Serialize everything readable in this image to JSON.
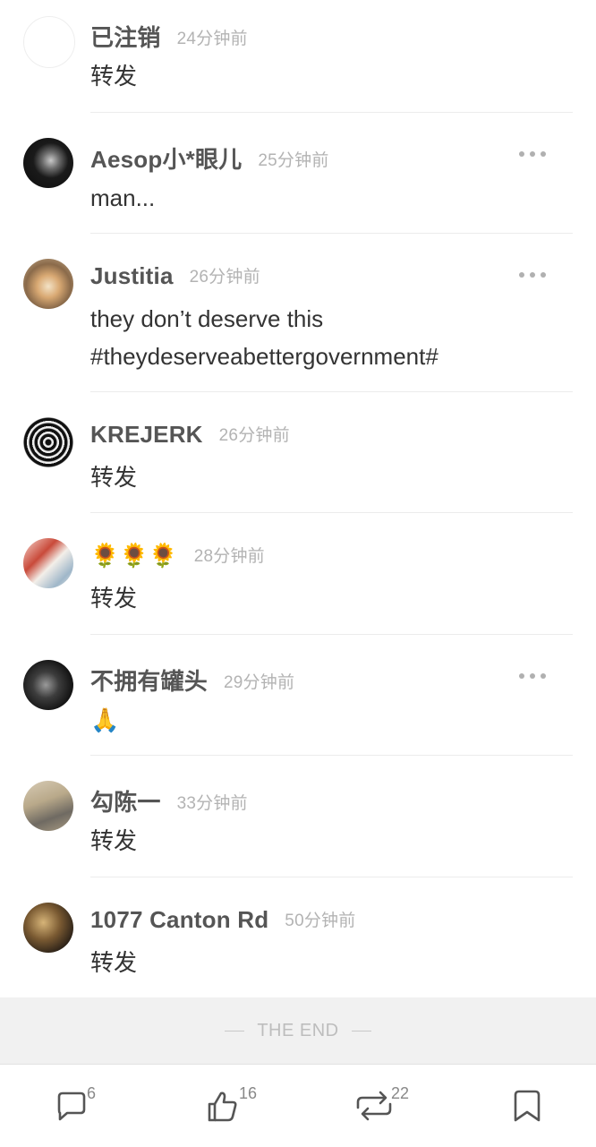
{
  "comments": [
    {
      "name": "已注销",
      "time": "24分钟前",
      "text": "转发",
      "more": false
    },
    {
      "name": "Aesop小*眼儿",
      "time": "25分钟前",
      "text": "man...",
      "more": true
    },
    {
      "name": "Justitia",
      "time": "26分钟前",
      "text": "they don’t deserve this #theydeserveabettergovernment#",
      "more": true
    },
    {
      "name": "KREJERK",
      "time": "26分钟前",
      "text": "转发",
      "more": false
    },
    {
      "name": "🌻🌻🌻",
      "time": "28分钟前",
      "text": "转发",
      "more": false
    },
    {
      "name": "不拥有罐头",
      "time": "29分钟前",
      "text": "🙏",
      "more": true
    },
    {
      "name": "勾陈一",
      "time": "33分钟前",
      "text": "转发",
      "more": false
    },
    {
      "name": "1077 Canton Rd",
      "time": "50分钟前",
      "text": "转发",
      "more": false
    }
  ],
  "footer": {
    "end_label": "THE END"
  },
  "toolbar": {
    "comment_count": "6",
    "like_count": "16",
    "repost_count": "22"
  }
}
